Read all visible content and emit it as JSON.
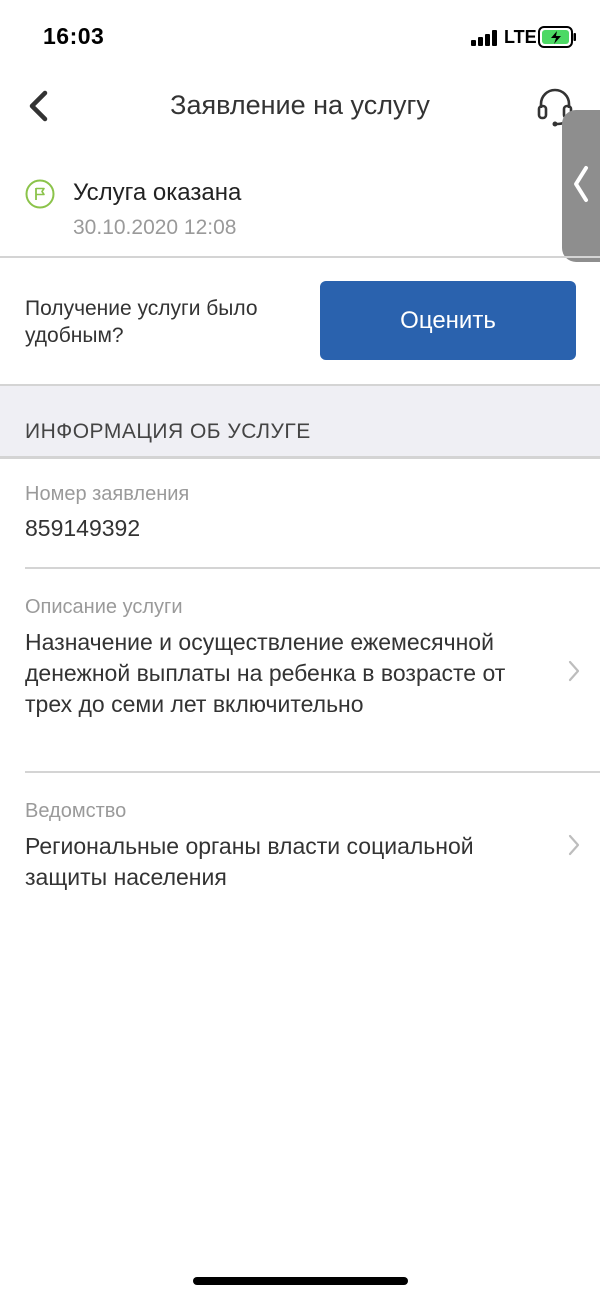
{
  "status_bar": {
    "time": "16:03",
    "network": "LTE"
  },
  "nav": {
    "title": "Заявление на услугу",
    "back_icon": "chevron-left-icon",
    "support_icon": "headset-icon"
  },
  "service_status": {
    "title": "Услуга оказана",
    "date": "30.10.2020 12:08",
    "icon": "flag-icon",
    "icon_color": "#8bc34a"
  },
  "rating": {
    "question": "Получение услуги было удобным?",
    "button_label": "Оценить",
    "button_color": "#2a62ae"
  },
  "section": {
    "title": "ИНФОРМАЦИЯ ОБ УСЛУГЕ"
  },
  "fields": [
    {
      "label": "Номер заявления",
      "value": "859149392"
    },
    {
      "label": "Описание услуги",
      "value": "Назначение и осуществление ежемесячной денежной выплаты на ребенка в возрасте от трех до семи лет включительно"
    },
    {
      "label": "Ведомство",
      "value": "Региональные органы власти социальной защиты населения"
    }
  ]
}
